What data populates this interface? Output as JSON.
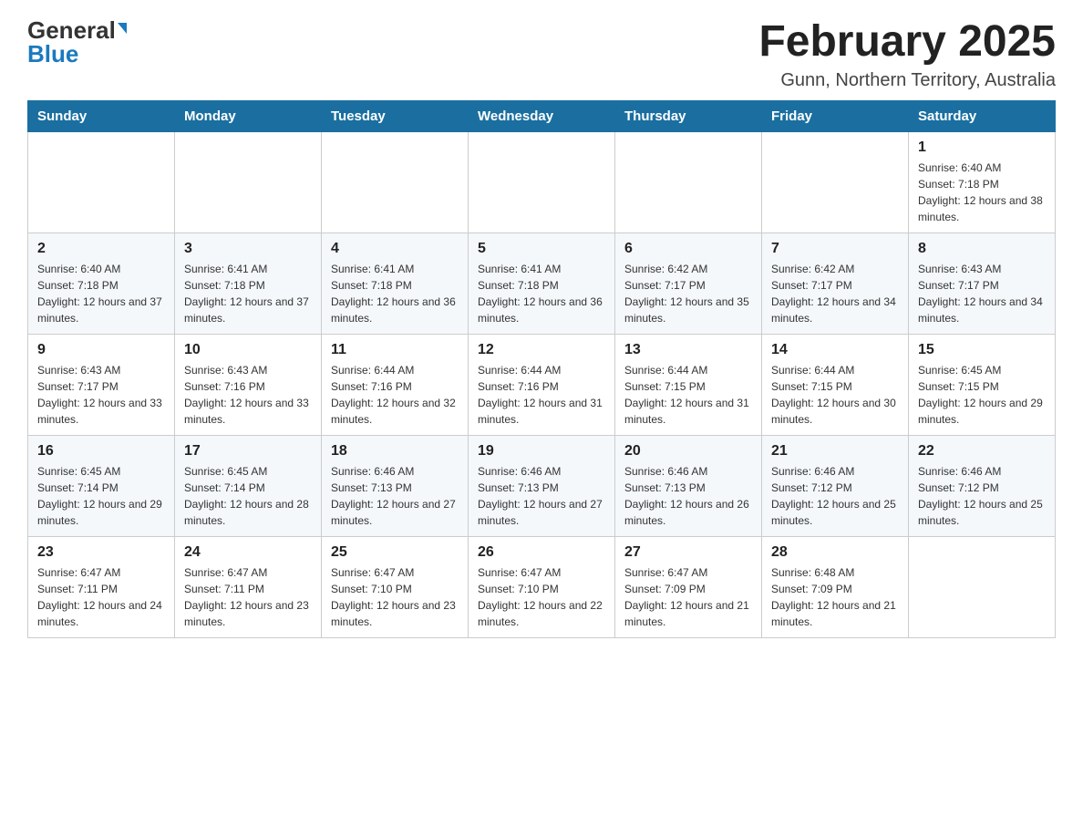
{
  "header": {
    "logo_general": "General",
    "logo_blue": "Blue",
    "month_title": "February 2025",
    "location": "Gunn, Northern Territory, Australia"
  },
  "days_of_week": [
    "Sunday",
    "Monday",
    "Tuesday",
    "Wednesday",
    "Thursday",
    "Friday",
    "Saturday"
  ],
  "weeks": [
    [
      {
        "day": "",
        "info": ""
      },
      {
        "day": "",
        "info": ""
      },
      {
        "day": "",
        "info": ""
      },
      {
        "day": "",
        "info": ""
      },
      {
        "day": "",
        "info": ""
      },
      {
        "day": "",
        "info": ""
      },
      {
        "day": "1",
        "info": "Sunrise: 6:40 AM\nSunset: 7:18 PM\nDaylight: 12 hours and 38 minutes."
      }
    ],
    [
      {
        "day": "2",
        "info": "Sunrise: 6:40 AM\nSunset: 7:18 PM\nDaylight: 12 hours and 37 minutes."
      },
      {
        "day": "3",
        "info": "Sunrise: 6:41 AM\nSunset: 7:18 PM\nDaylight: 12 hours and 37 minutes."
      },
      {
        "day": "4",
        "info": "Sunrise: 6:41 AM\nSunset: 7:18 PM\nDaylight: 12 hours and 36 minutes."
      },
      {
        "day": "5",
        "info": "Sunrise: 6:41 AM\nSunset: 7:18 PM\nDaylight: 12 hours and 36 minutes."
      },
      {
        "day": "6",
        "info": "Sunrise: 6:42 AM\nSunset: 7:17 PM\nDaylight: 12 hours and 35 minutes."
      },
      {
        "day": "7",
        "info": "Sunrise: 6:42 AM\nSunset: 7:17 PM\nDaylight: 12 hours and 34 minutes."
      },
      {
        "day": "8",
        "info": "Sunrise: 6:43 AM\nSunset: 7:17 PM\nDaylight: 12 hours and 34 minutes."
      }
    ],
    [
      {
        "day": "9",
        "info": "Sunrise: 6:43 AM\nSunset: 7:17 PM\nDaylight: 12 hours and 33 minutes."
      },
      {
        "day": "10",
        "info": "Sunrise: 6:43 AM\nSunset: 7:16 PM\nDaylight: 12 hours and 33 minutes."
      },
      {
        "day": "11",
        "info": "Sunrise: 6:44 AM\nSunset: 7:16 PM\nDaylight: 12 hours and 32 minutes."
      },
      {
        "day": "12",
        "info": "Sunrise: 6:44 AM\nSunset: 7:16 PM\nDaylight: 12 hours and 31 minutes."
      },
      {
        "day": "13",
        "info": "Sunrise: 6:44 AM\nSunset: 7:15 PM\nDaylight: 12 hours and 31 minutes."
      },
      {
        "day": "14",
        "info": "Sunrise: 6:44 AM\nSunset: 7:15 PM\nDaylight: 12 hours and 30 minutes."
      },
      {
        "day": "15",
        "info": "Sunrise: 6:45 AM\nSunset: 7:15 PM\nDaylight: 12 hours and 29 minutes."
      }
    ],
    [
      {
        "day": "16",
        "info": "Sunrise: 6:45 AM\nSunset: 7:14 PM\nDaylight: 12 hours and 29 minutes."
      },
      {
        "day": "17",
        "info": "Sunrise: 6:45 AM\nSunset: 7:14 PM\nDaylight: 12 hours and 28 minutes."
      },
      {
        "day": "18",
        "info": "Sunrise: 6:46 AM\nSunset: 7:13 PM\nDaylight: 12 hours and 27 minutes."
      },
      {
        "day": "19",
        "info": "Sunrise: 6:46 AM\nSunset: 7:13 PM\nDaylight: 12 hours and 27 minutes."
      },
      {
        "day": "20",
        "info": "Sunrise: 6:46 AM\nSunset: 7:13 PM\nDaylight: 12 hours and 26 minutes."
      },
      {
        "day": "21",
        "info": "Sunrise: 6:46 AM\nSunset: 7:12 PM\nDaylight: 12 hours and 25 minutes."
      },
      {
        "day": "22",
        "info": "Sunrise: 6:46 AM\nSunset: 7:12 PM\nDaylight: 12 hours and 25 minutes."
      }
    ],
    [
      {
        "day": "23",
        "info": "Sunrise: 6:47 AM\nSunset: 7:11 PM\nDaylight: 12 hours and 24 minutes."
      },
      {
        "day": "24",
        "info": "Sunrise: 6:47 AM\nSunset: 7:11 PM\nDaylight: 12 hours and 23 minutes."
      },
      {
        "day": "25",
        "info": "Sunrise: 6:47 AM\nSunset: 7:10 PM\nDaylight: 12 hours and 23 minutes."
      },
      {
        "day": "26",
        "info": "Sunrise: 6:47 AM\nSunset: 7:10 PM\nDaylight: 12 hours and 22 minutes."
      },
      {
        "day": "27",
        "info": "Sunrise: 6:47 AM\nSunset: 7:09 PM\nDaylight: 12 hours and 21 minutes."
      },
      {
        "day": "28",
        "info": "Sunrise: 6:48 AM\nSunset: 7:09 PM\nDaylight: 12 hours and 21 minutes."
      },
      {
        "day": "",
        "info": ""
      }
    ]
  ]
}
